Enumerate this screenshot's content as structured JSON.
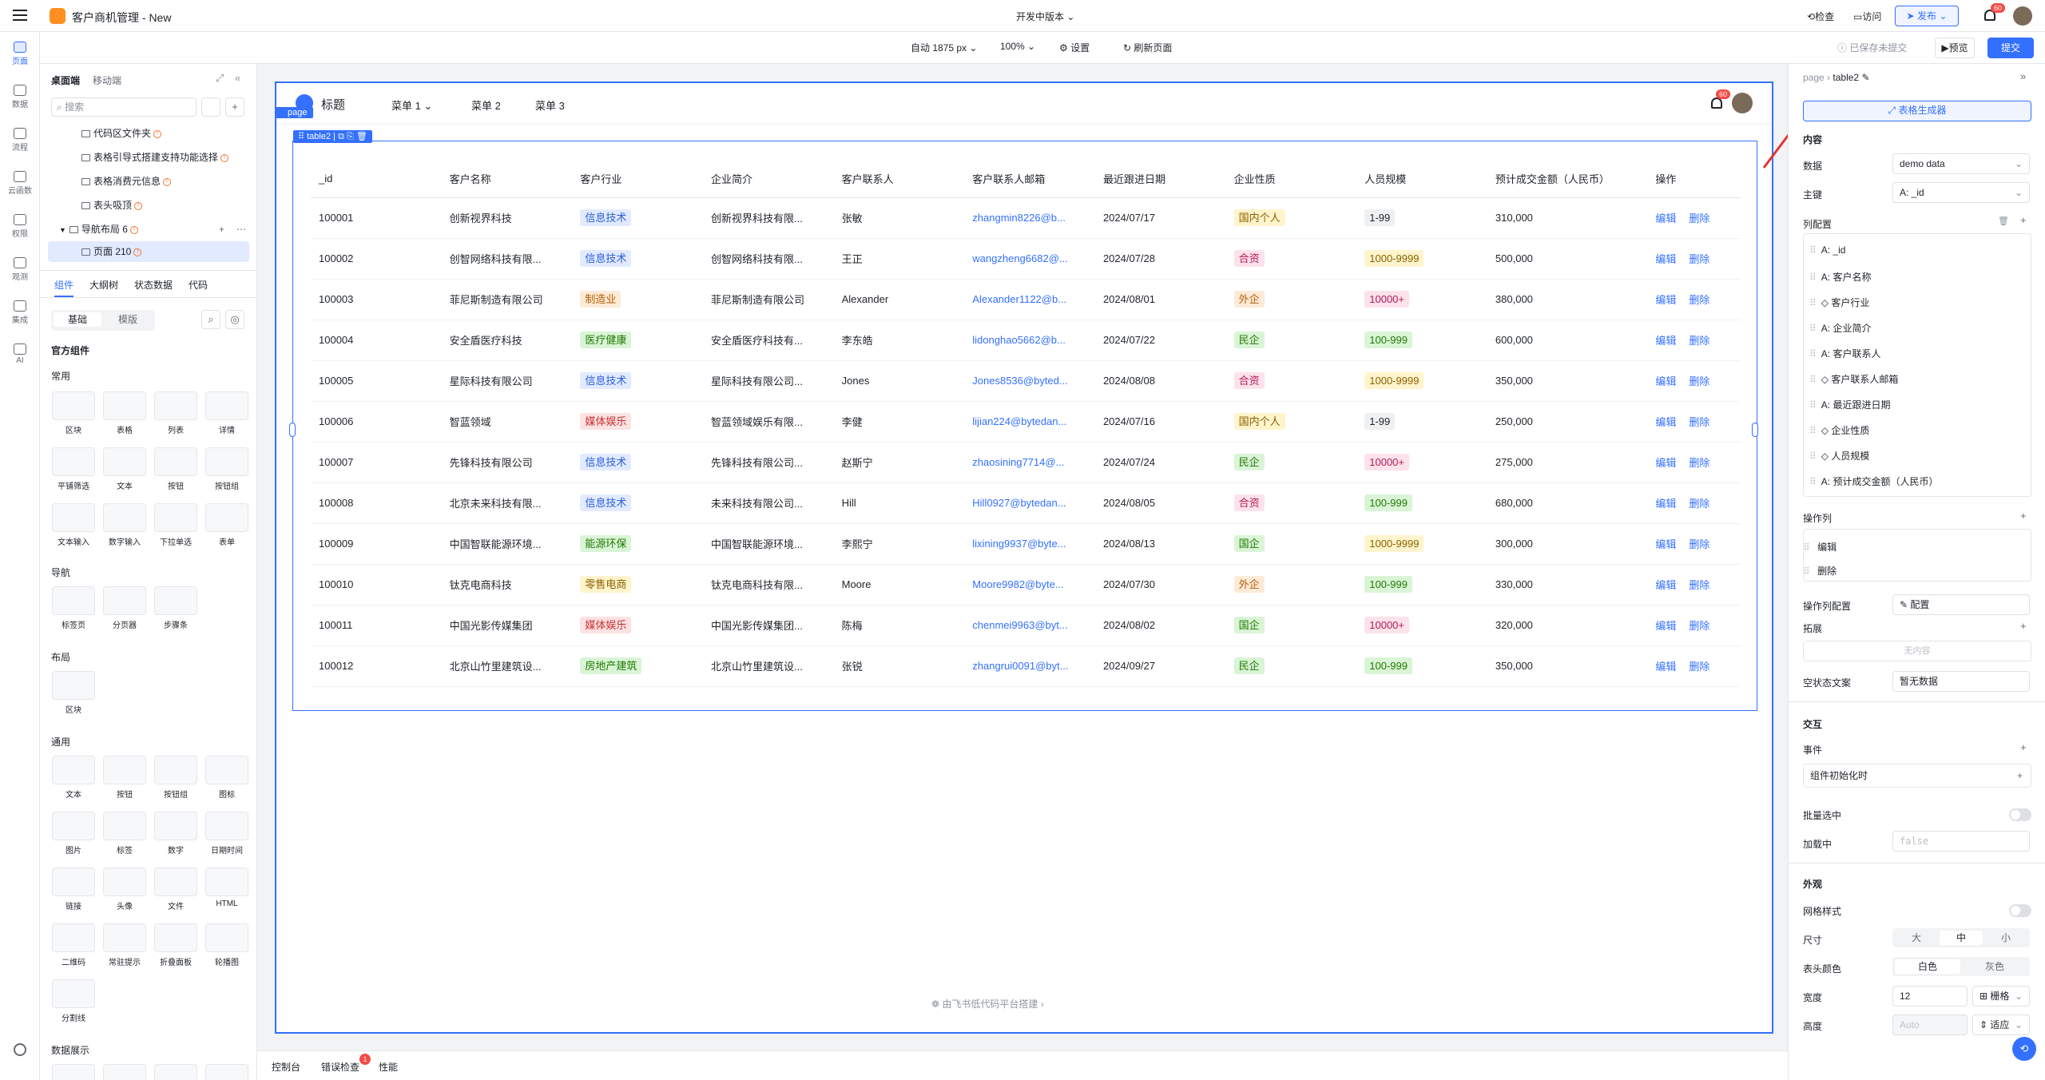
{
  "app": {
    "title": "客户商机管理 - New",
    "version": "开发中版本",
    "check": "检查",
    "visit": "访问",
    "publish": "发布",
    "notif": "60"
  },
  "toolbar2": {
    "auto": "自动 1875 px",
    "zoom": "100%",
    "settings": "设置",
    "refresh": "刷新页面",
    "saved": "已保存未提交",
    "preview": "预览",
    "submit": "提交"
  },
  "rail": [
    {
      "label": "页面"
    },
    {
      "label": "数据"
    },
    {
      "label": "流程"
    },
    {
      "label": "云函数"
    },
    {
      "label": "权限"
    },
    {
      "label": "观测"
    },
    {
      "label": "集成"
    },
    {
      "label": "AI"
    }
  ],
  "lp": {
    "tab_desktop": "桌面端",
    "tab_mobile": "移动端",
    "search_placeholder": "搜索",
    "tree": [
      {
        "label": "代码区文件夹"
      },
      {
        "label": "表格引导式搭建支持功能选择"
      },
      {
        "label": "表格消费元信息"
      },
      {
        "label": "表头吸顶"
      },
      {
        "label": "导航布局 6"
      },
      {
        "label": "页面 210"
      }
    ],
    "tabs": [
      "组件",
      "大纲树",
      "状态数据",
      "代码"
    ],
    "seg_basic": "基础",
    "seg_template": "模版",
    "official": "官方组件",
    "common": "常用",
    "nav": "导航",
    "layout": "布局",
    "general": "通用",
    "display": "数据展示",
    "common_items": [
      "区块",
      "表格",
      "列表",
      "详情",
      "平铺筛选",
      "文本",
      "按钮",
      "按钮组",
      "文本输入",
      "数字输入",
      "下拉单选",
      "表单"
    ],
    "nav_items": [
      "标签页",
      "分页器",
      "步骤条"
    ],
    "layout_items": [
      "区块"
    ],
    "general_items": [
      "文本",
      "按钮",
      "按钮组",
      "图标",
      "图片",
      "标签",
      "数字",
      "日期时间",
      "链接",
      "头像",
      "文件",
      "HTML",
      "二维码",
      "常驻提示",
      "折叠面板",
      "轮播图",
      "分割线"
    ]
  },
  "page": {
    "badge": "page",
    "table_badge": "table2",
    "title": "标题",
    "menus": [
      "菜单 1",
      "菜单 2",
      "菜单 3"
    ],
    "notif": "60",
    "footer": "由飞书低代码平台搭建"
  },
  "table": {
    "columns": [
      "_id",
      "客户名称",
      "客户行业",
      "企业简介",
      "客户联系人",
      "客户联系人邮箱",
      "最近跟进日期",
      "企业性质",
      "人员规模",
      "预计成交金额（人民币）",
      "操作"
    ],
    "edit": "编辑",
    "del": "删除",
    "rows": [
      [
        "100001",
        "创新视界科技",
        "信息技术",
        "创新视界科技有限...",
        "张敏",
        "zhangmin8226@b...",
        "2024/07/17",
        "国内个人",
        "1-99",
        "310,000"
      ],
      [
        "100002",
        "创智网络科技有限...",
        "信息技术",
        "创智网络科技有限...",
        "王正",
        "wangzheng6682@...",
        "2024/07/28",
        "合资",
        "1000-9999",
        "500,000"
      ],
      [
        "100003",
        "菲尼斯制造有限公司",
        "制造业",
        "菲尼斯制造有限公司",
        "Alexander",
        "Alexander1122@b...",
        "2024/08/01",
        "外企",
        "10000+",
        "380,000"
      ],
      [
        "100004",
        "安全盾医疗科技",
        "医疗健康",
        "安全盾医疗科技有...",
        "李东皓",
        "lidonghao5662@b...",
        "2024/07/22",
        "民企",
        "100-999",
        "600,000"
      ],
      [
        "100005",
        "星际科技有限公司",
        "信息技术",
        "星际科技有限公司...",
        "Jones",
        "Jones8536@byted...",
        "2024/08/08",
        "合资",
        "1000-9999",
        "350,000"
      ],
      [
        "100006",
        "智蓝领域",
        "媒体娱乐",
        "智蓝领域娱乐有限...",
        "李健",
        "lijian224@bytedan...",
        "2024/07/16",
        "国内个人",
        "1-99",
        "250,000"
      ],
      [
        "100007",
        "先锋科技有限公司",
        "信息技术",
        "先锋科技有限公司...",
        "赵斯宁",
        "zhaosining7714@...",
        "2024/07/24",
        "民企",
        "10000+",
        "275,000"
      ],
      [
        "100008",
        "北京未来科技有限...",
        "信息技术",
        "未来科技有限公司...",
        "Hill",
        "Hill0927@bytedan...",
        "2024/08/05",
        "合资",
        "100-999",
        "680,000"
      ],
      [
        "100009",
        "中国智联能源环境...",
        "能源环保",
        "中国智联能源环境...",
        "李熙宁",
        "lixining9937@byte...",
        "2024/08/13",
        "国企",
        "1000-9999",
        "300,000"
      ],
      [
        "100010",
        "钛克电商科技",
        "零售电商",
        "钛克电商科技有限...",
        "Moore",
        "Moore9982@byte...",
        "2024/07/30",
        "外企",
        "100-999",
        "330,000"
      ],
      [
        "100011",
        "中国光影传媒集团",
        "媒体娱乐",
        "中国光影传媒集团...",
        "陈梅",
        "chenmei9963@byt...",
        "2024/08/02",
        "国企",
        "10000+",
        "320,000"
      ],
      [
        "100012",
        "北京山竹里建筑设...",
        "房地产建筑",
        "北京山竹里建筑设...",
        "张锐",
        "zhangrui0091@byt...",
        "2024/09/27",
        "民企",
        "100-999",
        "350,000"
      ]
    ]
  },
  "colors": {
    "信息技术": "#e1eaff|#2b5fd9",
    "制造业": "#fdebd8|#b85d00",
    "医疗健康": "#d9f5d6|#237804",
    "媒体娱乐": "#fde2e2|#c53030",
    "能源环保": "#d9f5d6|#237804",
    "零售电商": "#fff4cc|#8a6100",
    "房地产建筑": "#d9f5d6|#237804",
    "国内个人": "#fff4cc|#8a6100",
    "合资": "#fde2ea|#b3195a",
    "外企": "#fdebd8|#b85d00",
    "民企": "#d9f5d6|#237804",
    "国企": "#d9f5d6|#237804",
    "1-99": "#eff0f1|#1f2329",
    "1000-9999": "#fff4cc|#8a6100",
    "10000+": "#fde2ea|#b3195a",
    "100-999": "#d9f5d6|#237804"
  },
  "bottom": {
    "console": "控制台",
    "errors": "错误检查",
    "err_count": "1",
    "perf": "性能"
  },
  "rp": {
    "bc_page": "page",
    "bc_table": "table2",
    "gen": "表格生成器",
    "content": "内容",
    "data_label": "数据",
    "data_val": "demo data",
    "key_label": "主键",
    "key_val": "A: _id",
    "colconf": "列配置",
    "cols": [
      "A: _id",
      "A: 客户名称",
      "◇ 客户行业",
      "A: 企业简介",
      "A: 客户联系人",
      "◇ 客户联系人邮箱",
      "A: 最近跟进日期",
      "◇ 企业性质",
      "◇ 人员规模",
      "A: 预计成交金额（人民币）"
    ],
    "opcol": "操作列",
    "ops": [
      "编辑",
      "删除"
    ],
    "opconf": "操作列配置",
    "opconf_btn": "配置",
    "expand": "拓展",
    "empty_none": "无内容",
    "empty_text_label": "空状态文案",
    "empty_text_val": "暂无数据",
    "interact": "交互",
    "events": "事件",
    "evt_init": "组件初始化时",
    "batch": "批量选中",
    "loading": "加载中",
    "loading_val": "false",
    "appearance": "外观",
    "grid": "网格样式",
    "size": "尺寸",
    "sizes": [
      "大",
      "中",
      "小"
    ],
    "headcolor": "表头颜色",
    "headcolors": [
      "白色",
      "灰色"
    ],
    "width": "宽度",
    "width_val": "12",
    "width_unit": "栅格",
    "height": "高度",
    "height_val": "Auto",
    "height_unit": "适应"
  }
}
